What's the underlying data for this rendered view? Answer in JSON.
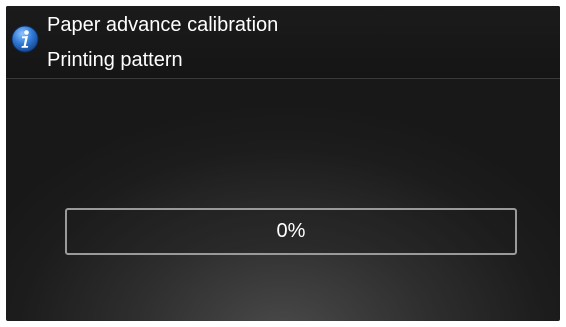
{
  "header": {
    "icon": "info-icon",
    "title": "Paper advance calibration",
    "subtitle": "Printing pattern"
  },
  "progress": {
    "percent": 0,
    "label": "0%"
  },
  "colors": {
    "icon_blue": "#2b6fc2",
    "text": "#ffffff",
    "bar_border": "#9a9a9a"
  }
}
